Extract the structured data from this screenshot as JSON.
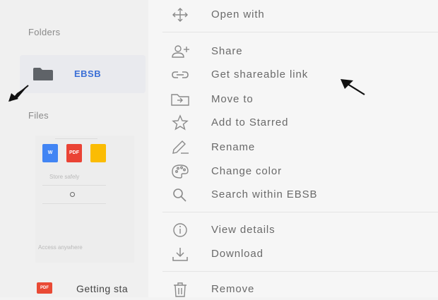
{
  "sidebar": {
    "folders_label": "Folders",
    "folder": {
      "name": "EBSB",
      "color": "#5f6368"
    },
    "files_label": "Files",
    "promo": {
      "line1": "Store safely",
      "line2": "Access anywhere",
      "icons": [
        {
          "name": "word-doc-icon",
          "text": "W",
          "color": "#4285f4"
        },
        {
          "name": "pdf-doc-icon",
          "text": "PDF",
          "color": "#ea4335"
        },
        {
          "name": "slides-doc-icon",
          "text": "",
          "color": "#fbbc04"
        }
      ]
    },
    "file": {
      "name": "Getting sta",
      "badge": "PDF"
    }
  },
  "context_menu": {
    "items": [
      {
        "label": "Open with",
        "icon": "open-with-icon"
      },
      {
        "label": "Share",
        "icon": "add-person-icon"
      },
      {
        "label": "Get shareable link",
        "icon": "link-icon"
      },
      {
        "label": "Move to",
        "icon": "move-to-folder-icon"
      },
      {
        "label": "Add to Starred",
        "icon": "star-icon"
      },
      {
        "label": "Rename",
        "icon": "pencil-icon"
      },
      {
        "label": "Change color",
        "icon": "palette-icon"
      },
      {
        "label": "Search within EBSB",
        "icon": "search-icon"
      },
      {
        "label": "View details",
        "icon": "info-icon"
      },
      {
        "label": "Download",
        "icon": "download-icon"
      },
      {
        "label": "Remove",
        "icon": "trash-icon"
      }
    ]
  },
  "colors": {
    "accent": "#3b6fd6",
    "pdf_red": "#e94a35"
  }
}
